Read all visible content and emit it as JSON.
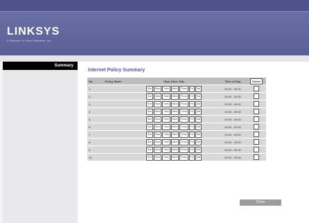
{
  "brand": {
    "logo_text": "LINKSYS",
    "logo_sub": "A Division of Cisco Systems, Inc."
  },
  "sidebar": {
    "items": [
      {
        "label": "Summary"
      }
    ]
  },
  "main": {
    "title": "Internet Policy Summary",
    "columns": [
      "No.",
      "Policy Name",
      "Days (Sun, Sat)",
      "Time of Day",
      "Delete"
    ],
    "rows": [
      {
        "no": "1.",
        "time": "00:00 - 00:00"
      },
      {
        "no": "2.",
        "time": "00:00 - 00:00"
      },
      {
        "no": "3.",
        "time": "00:00 - 00:00"
      },
      {
        "no": "4.",
        "time": "00:00 - 00:00"
      },
      {
        "no": "5.",
        "time": "00:00 - 00:00"
      },
      {
        "no": "6.",
        "time": "00:00 - 00:00"
      },
      {
        "no": "7.",
        "time": "00:00 - 00:00"
      },
      {
        "no": "8.",
        "time": "00:00 - 00:00"
      },
      {
        "no": "9.",
        "time": "00:00 - 00:00"
      },
      {
        "no": "10.",
        "time": "00:00 - 00:00"
      }
    ],
    "day_labels": [
      "Sun",
      "Mon",
      "Tues",
      "Wed",
      "Thurs",
      "Fri",
      "Sat"
    ],
    "close_label": "Close"
  },
  "colors": {
    "header": "#5a5f96",
    "title": "#4a5aa8",
    "table_header": "#bdbdbd",
    "table_cell": "#d8d8d8",
    "button": "#9b9b9b"
  }
}
